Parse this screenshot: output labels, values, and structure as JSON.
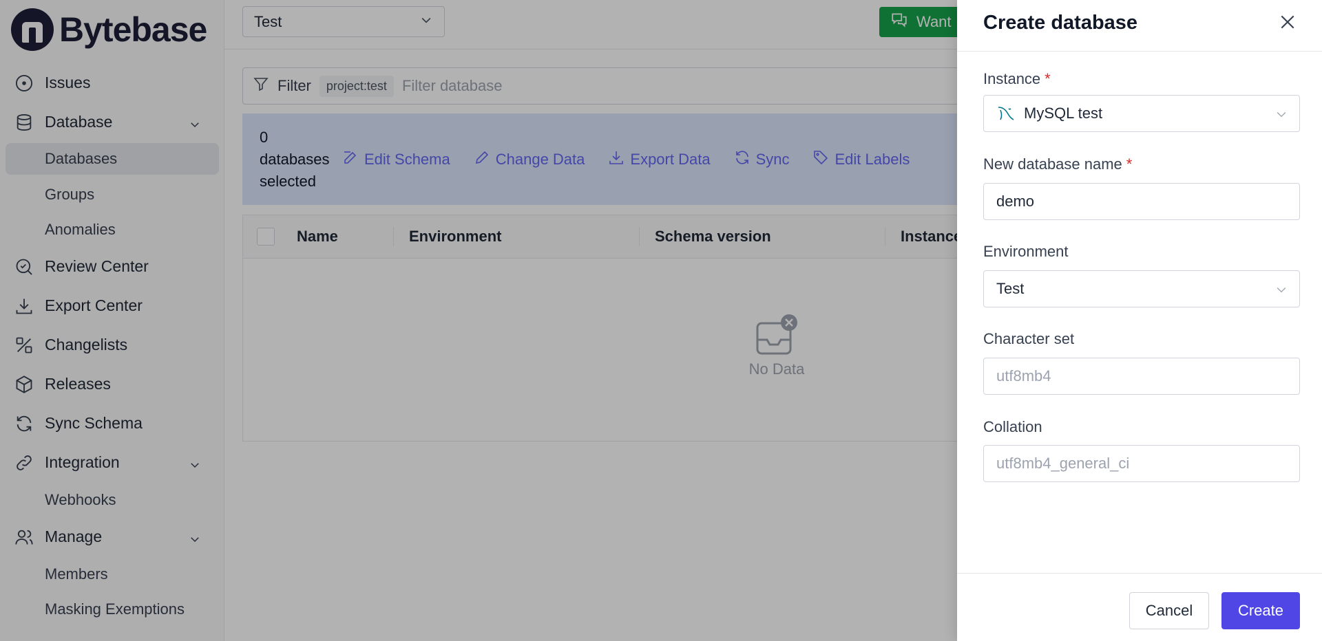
{
  "brand": {
    "name": "Bytebase"
  },
  "sidebar": {
    "items": [
      {
        "label": "Issues",
        "icon": "circle-dot-icon"
      },
      {
        "label": "Database",
        "icon": "database-icon",
        "expanded": true,
        "children": [
          "Databases",
          "Groups",
          "Anomalies"
        ],
        "active_child": "Databases"
      },
      {
        "label": "Review Center",
        "icon": "review-icon"
      },
      {
        "label": "Export Center",
        "icon": "download-icon"
      },
      {
        "label": "Changelists",
        "icon": "changelist-icon"
      },
      {
        "label": "Releases",
        "icon": "package-icon"
      },
      {
        "label": "Sync Schema",
        "icon": "refresh-icon"
      },
      {
        "label": "Integration",
        "icon": "link-icon",
        "expanded": true,
        "children": [
          "Webhooks"
        ]
      },
      {
        "label": "Manage",
        "icon": "users-icon",
        "expanded": true,
        "children": [
          "Members",
          "Masking Exemptions"
        ]
      }
    ]
  },
  "main": {
    "project_select": {
      "value": "Test"
    },
    "want_button": {
      "label": "Want"
    },
    "filter": {
      "label": "Filter",
      "chip": "project:test",
      "placeholder": "Filter database"
    },
    "selection": {
      "count_text_1": "0",
      "count_text_2": "databases",
      "count_text_3": "selected"
    },
    "actions": [
      "Edit Schema",
      "Change Data",
      "Export Data",
      "Sync",
      "Edit Labels"
    ],
    "table": {
      "columns": [
        "Name",
        "Environment",
        "Schema version",
        "Instance"
      ],
      "empty_text": "No Data"
    }
  },
  "drawer": {
    "title": "Create database",
    "instance": {
      "label": "Instance",
      "value": "MySQL test"
    },
    "db_name": {
      "label": "New database name",
      "value": "demo"
    },
    "environment": {
      "label": "Environment",
      "value": "Test"
    },
    "charset": {
      "label": "Character set",
      "placeholder": "utf8mb4"
    },
    "collation": {
      "label": "Collation",
      "placeholder": "utf8mb4_general_ci"
    },
    "cancel_label": "Cancel",
    "create_label": "Create",
    "required_mark": "*"
  },
  "colors": {
    "accent": "#4f46e5",
    "want_button": "#16a34a",
    "selection_bar": "#dbe6fb",
    "required": "#dc2626"
  }
}
